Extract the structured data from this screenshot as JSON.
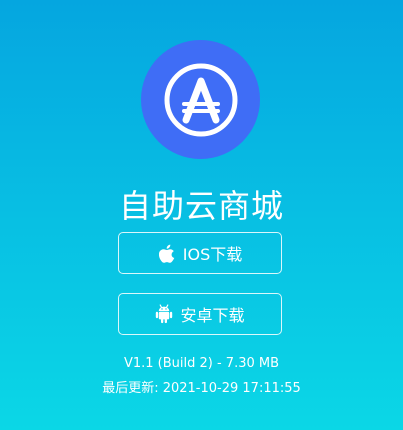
{
  "app": {
    "logo_icon": "app-store-a-icon",
    "title": "自助云商城",
    "logo_color": "#3f6df6"
  },
  "buttons": {
    "ios_label": "IOS下载",
    "ios_icon": "apple-icon",
    "android_label": "安卓下载",
    "android_icon": "android-icon"
  },
  "meta": {
    "version": "V1.1 (Build 2) - 7.30 MB",
    "updated": "最后更新: 2021-10-29 17:11:55"
  },
  "colors": {
    "background_top": "#05a6e0",
    "background_bottom": "#0bd7e6",
    "text": "#ffffff"
  }
}
